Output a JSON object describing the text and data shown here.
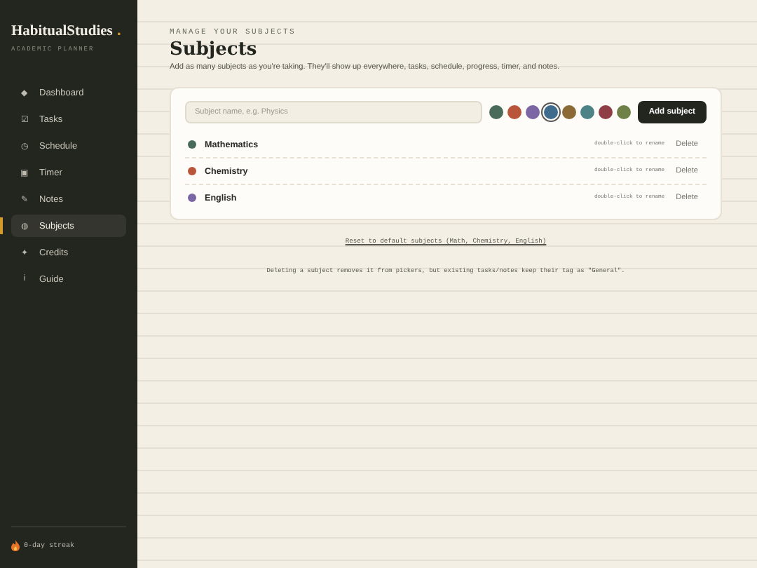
{
  "brand": {
    "name": "HabitualStudies",
    "dot": ".",
    "tagline": "ACADEMIC PLANNER"
  },
  "nav": [
    {
      "icon": "◆",
      "label": "Dashboard",
      "selected": false
    },
    {
      "icon": "☑",
      "label": "Tasks",
      "selected": false
    },
    {
      "icon": "◷",
      "label": "Schedule",
      "selected": false
    },
    {
      "icon": "▣",
      "label": "Timer",
      "selected": false
    },
    {
      "icon": "✎",
      "label": "Notes",
      "selected": false
    },
    {
      "icon": "◍",
      "label": "Subjects",
      "selected": true
    },
    {
      "icon": "✦",
      "label": "Credits",
      "selected": false
    },
    {
      "icon": "i",
      "label": "Guide",
      "selected": false
    }
  ],
  "streak": {
    "text": "0-day streak"
  },
  "header": {
    "eyebrow": "MANAGE YOUR SUBJECTS",
    "title": "Subjects",
    "subtitle": "Add as many subjects as you're taking. They'll show up everywhere, tasks, schedule, progress, timer, and notes."
  },
  "form": {
    "placeholder": "Subject name, e.g. Physics",
    "button": "Add subject",
    "swatches": [
      {
        "color": "#4a6b5a",
        "selected": false
      },
      {
        "color": "#b8553a",
        "selected": false
      },
      {
        "color": "#7c67a4",
        "selected": false
      },
      {
        "color": "#3f6c8c",
        "selected": true
      },
      {
        "color": "#8c6a35",
        "selected": false
      },
      {
        "color": "#4d8286",
        "selected": false
      },
      {
        "color": "#8e3f45",
        "selected": false
      },
      {
        "color": "#6f8148",
        "selected": false
      }
    ]
  },
  "subjects": [
    {
      "name": "Mathematics",
      "color": "#4a6b5a",
      "hint": "double-click to rename",
      "action": "Delete"
    },
    {
      "name": "Chemistry",
      "color": "#b8553a",
      "hint": "double-click to rename",
      "action": "Delete"
    },
    {
      "name": "English",
      "color": "#7c67a4",
      "hint": "double-click to rename",
      "action": "Delete"
    }
  ],
  "reset_link": "Reset to default subjects (Math, Chemistry, English)",
  "footnote": "Deleting a subject removes it from pickers, but existing tasks/notes keep their tag as \"General\"."
}
